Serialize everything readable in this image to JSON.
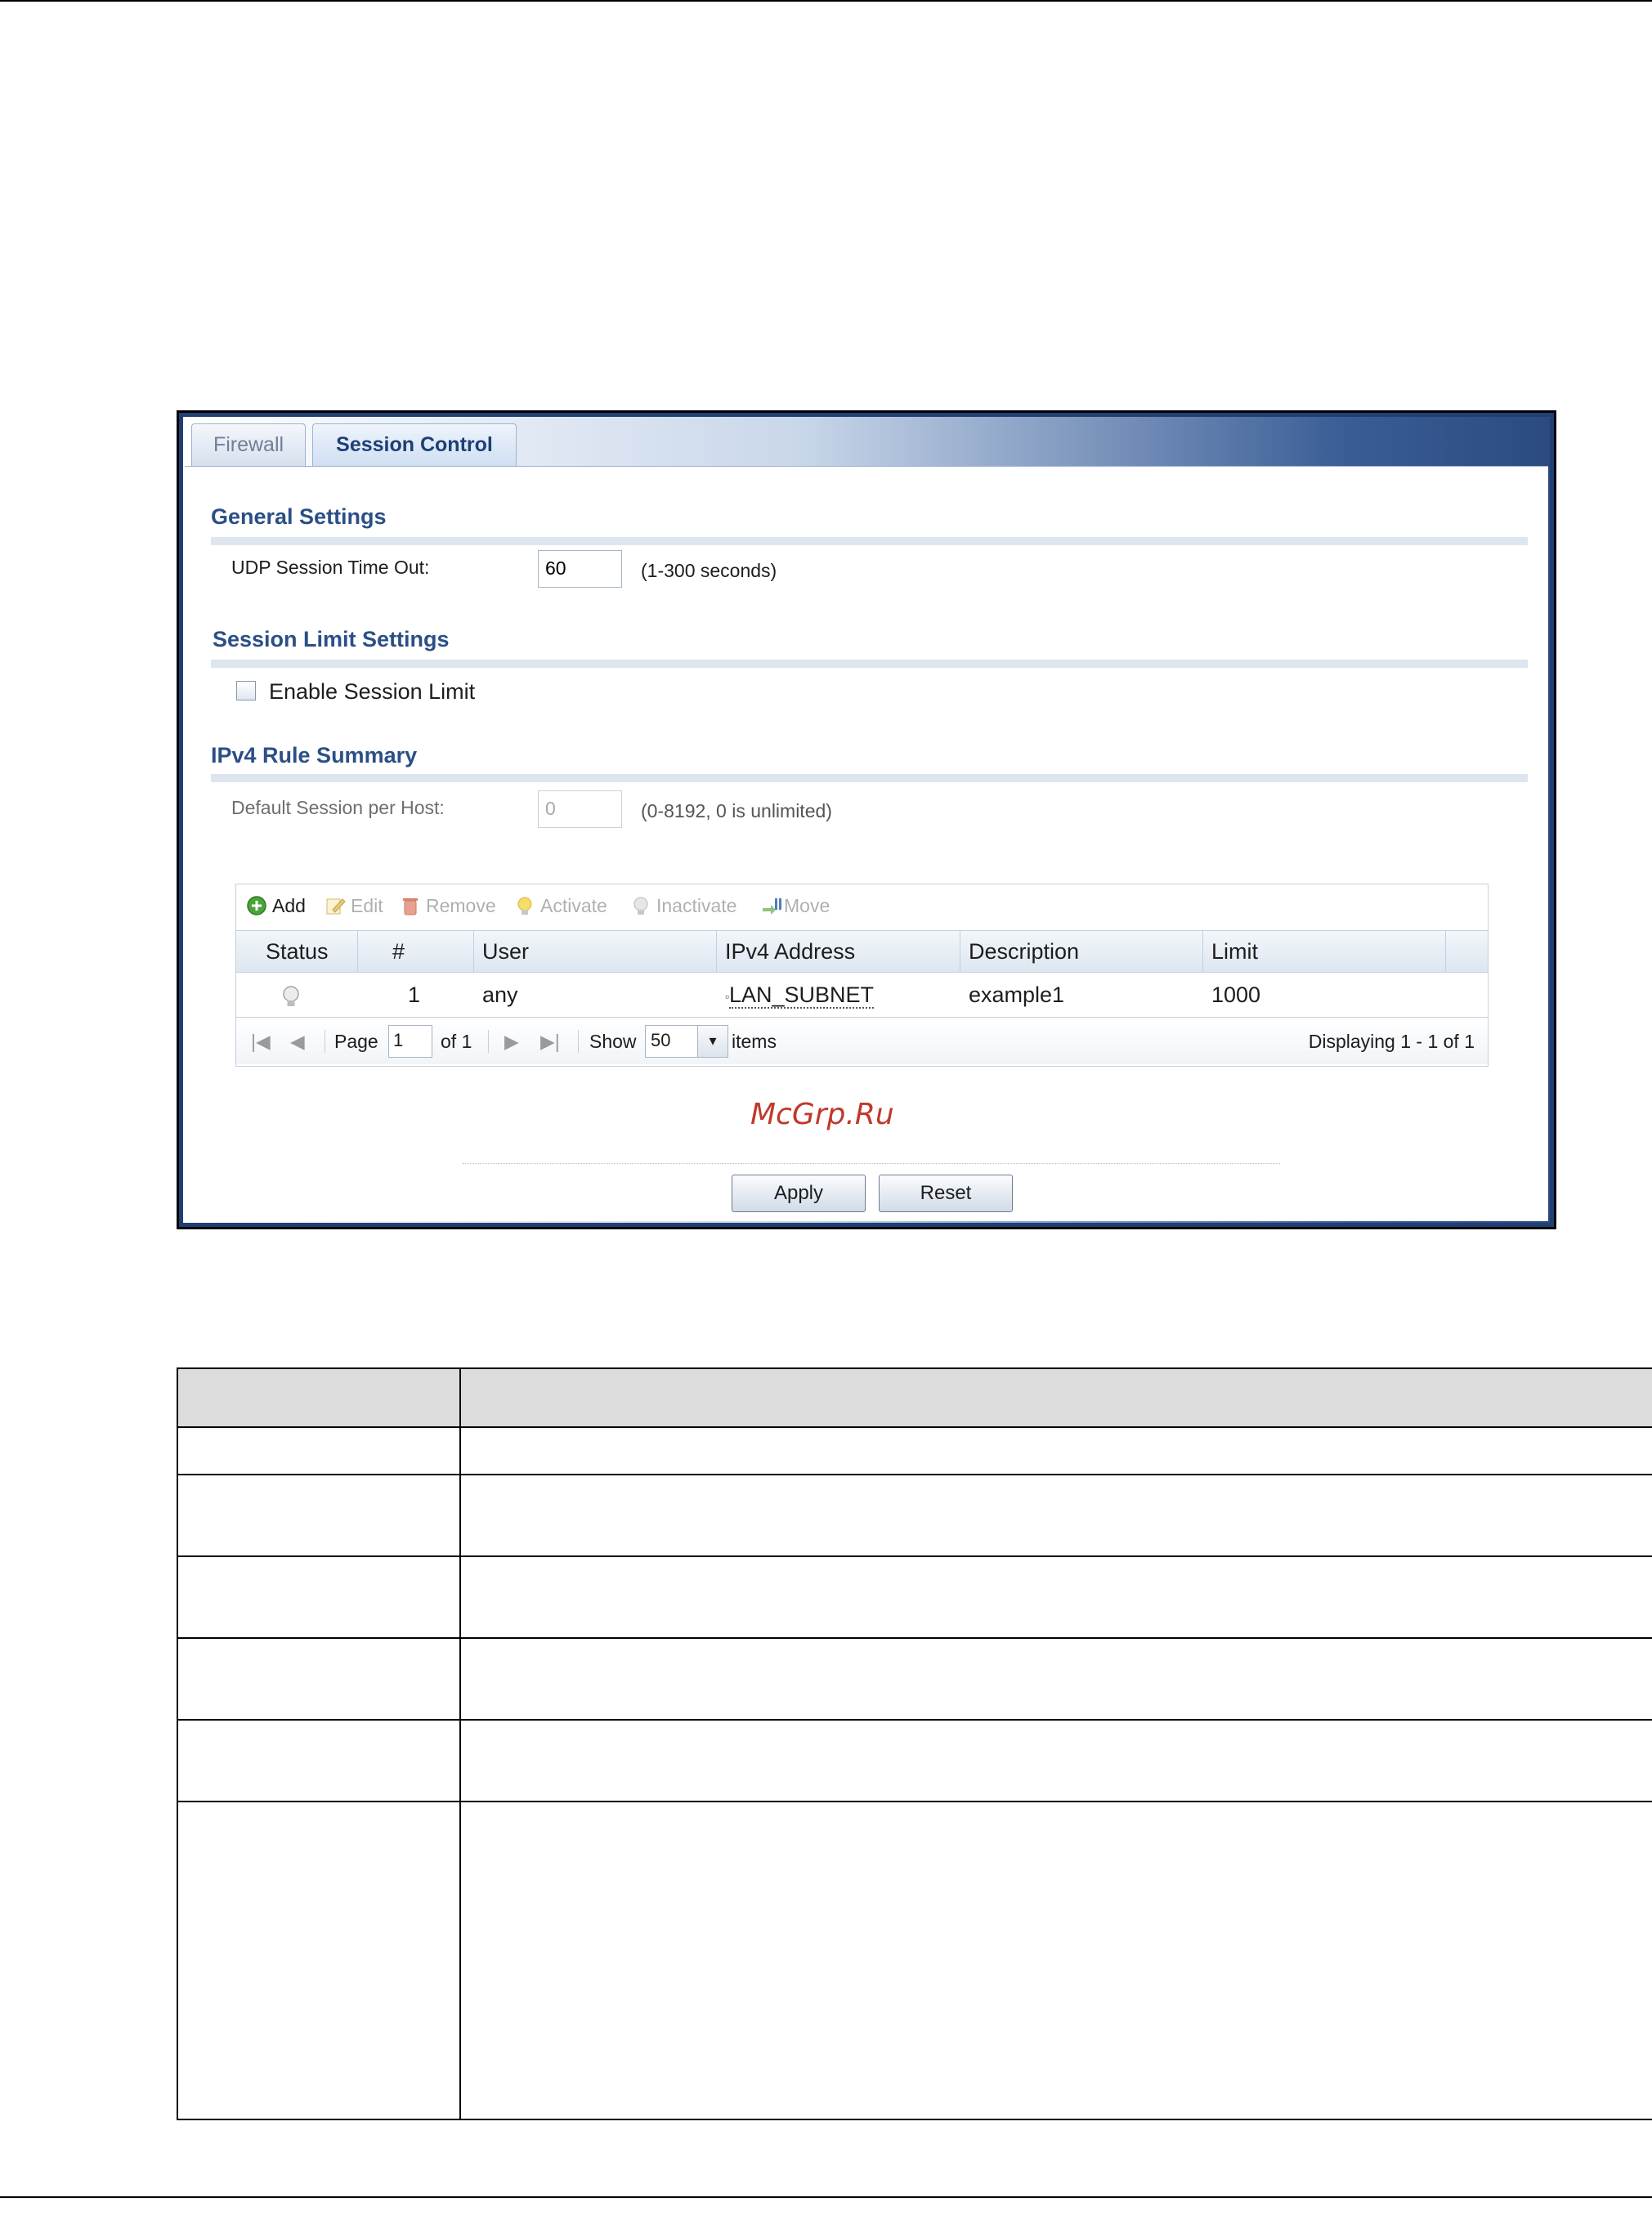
{
  "tabs": [
    {
      "label": "Firewall",
      "active": false
    },
    {
      "label": "Session Control",
      "active": true
    }
  ],
  "general": {
    "title": "General Settings",
    "udp_label": "UDP Session Time Out:",
    "udp_value": "60",
    "udp_hint": "(1-300 seconds)"
  },
  "session_limit": {
    "title": "Session Limit Settings",
    "enable_label": "Enable Session Limit",
    "enabled": false
  },
  "rule_summary": {
    "title": "IPv4 Rule Summary",
    "default_label": "Default Session per Host:",
    "default_value": "0",
    "default_hint": "(0-8192, 0 is unlimited)"
  },
  "toolbar": {
    "add": "Add",
    "edit": "Edit",
    "remove": "Remove",
    "activate": "Activate",
    "inactivate": "Inactivate",
    "move": "Move"
  },
  "grid": {
    "columns": [
      "Status",
      "#",
      "User",
      "IPv4 Address",
      "Description",
      "Limit"
    ],
    "rows": [
      {
        "status_icon": "inactive-bulb-icon",
        "num": "1",
        "user": "any",
        "address": "LAN_SUBNET",
        "description": "example1",
        "limit": "1000"
      }
    ]
  },
  "pager": {
    "page_label": "Page",
    "page_value": "1",
    "of_label": "of 1",
    "show_label": "Show",
    "show_value": "50",
    "items_label": "items",
    "displaying": "Displaying 1 - 1 of 1"
  },
  "watermark": "McGrp.Ru",
  "buttons": {
    "apply": "Apply",
    "reset": "Reset"
  },
  "colors": {
    "section_title": "#2b4f86",
    "frame": "#1f3f72",
    "watermark": "#c0392b"
  }
}
